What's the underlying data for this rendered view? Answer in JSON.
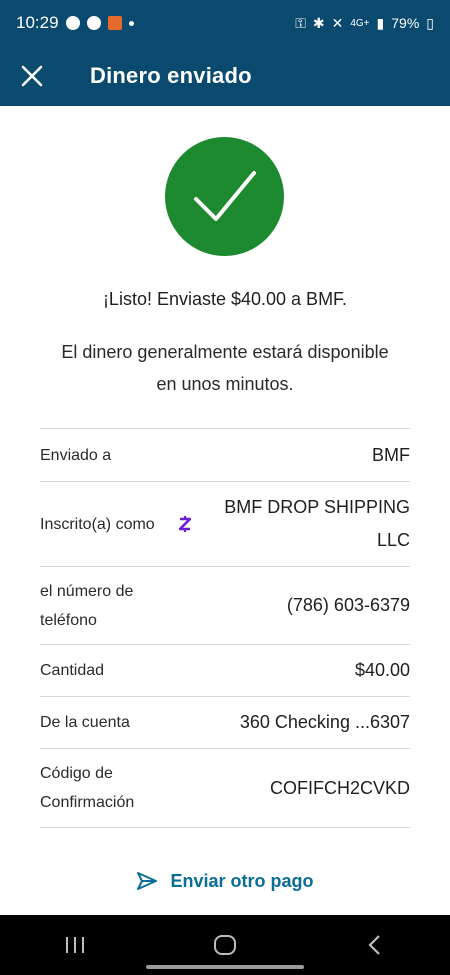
{
  "status_bar": {
    "time": "10:29",
    "signal": "4G+",
    "battery": "79%"
  },
  "header": {
    "title": "Dinero enviado"
  },
  "confirmation": {
    "message": "¡Listo! Enviaste $40.00 a BMF.",
    "note": "El dinero generalmente estará disponible en unos minutos."
  },
  "details": {
    "rows": [
      {
        "label": "Enviado a",
        "value": "BMF"
      },
      {
        "label": "Inscrito(a) como",
        "value": "BMF DROP SHIPPING LLC",
        "icon": "zelle-icon"
      },
      {
        "label": "el número de teléfono",
        "value": "(786) 603-6379"
      },
      {
        "label": "Cantidad",
        "value": "$40.00"
      },
      {
        "label": "De la cuenta",
        "value": "360 Checking ...6307"
      },
      {
        "label": "Código de Confirmación",
        "value": "COFIFCH2CVKD"
      }
    ]
  },
  "actions": {
    "send_another": "Enviar otro pago"
  },
  "colors": {
    "header_bg": "#0b4a6f",
    "success_green": "#1e8a2f",
    "link_blue": "#0b6e96",
    "zelle_purple": "#6d1ed4"
  },
  "icons": {
    "close": "close-icon",
    "check": "checkmark-icon",
    "send": "send-icon",
    "recent_apps": "recent-apps-icon",
    "home": "home-icon",
    "back": "back-icon"
  }
}
